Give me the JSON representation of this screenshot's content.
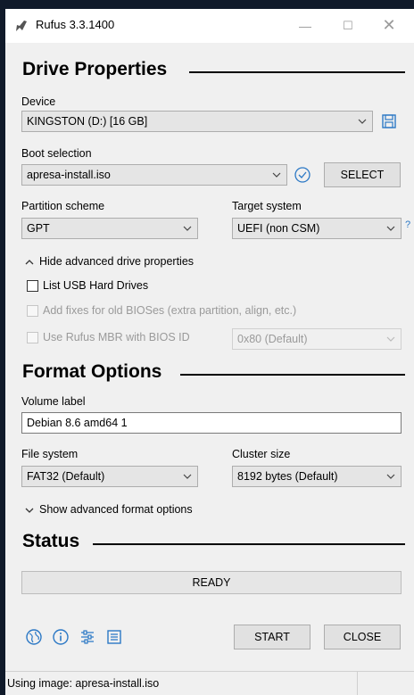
{
  "window": {
    "title": "Rufus 3.3.1400",
    "minimize_glyph": "—",
    "maximize_glyph": "☐",
    "close_glyph": "✕"
  },
  "drive_properties": {
    "heading": "Drive Properties",
    "device_label": "Device",
    "device_value": "KINGSTON (D:) [16 GB]",
    "boot_label": "Boot selection",
    "boot_value": "apresa-install.iso",
    "select_button": "SELECT",
    "partition_label": "Partition scheme",
    "partition_value": "GPT",
    "target_label": "Target system",
    "target_value": "UEFI (non CSM)",
    "help_glyph": "?",
    "advanced_toggle": "Hide advanced drive properties",
    "list_usb": "List USB Hard Drives",
    "old_bios": "Add fixes for old BIOSes (extra partition, align, etc.)",
    "rufus_mbr": "Use Rufus MBR with BIOS ID",
    "bios_id_value": "0x80 (Default)"
  },
  "format_options": {
    "heading": "Format Options",
    "volume_label_label": "Volume label",
    "volume_label_value": "Debian 8.6 amd64 1",
    "fs_label": "File system",
    "fs_value": "FAT32 (Default)",
    "cluster_label": "Cluster size",
    "cluster_value": "8192 bytes (Default)",
    "advanced_toggle": "Show advanced format options"
  },
  "status": {
    "heading": "Status",
    "progress_text": "READY",
    "progress_fraction": 0
  },
  "actions": {
    "start": "START",
    "close": "CLOSE"
  },
  "statusbar": {
    "text": "Using image: apresa-install.iso"
  },
  "colors": {
    "accent_blue": "#2b78c5",
    "window_bg": "#f0f0f0"
  }
}
